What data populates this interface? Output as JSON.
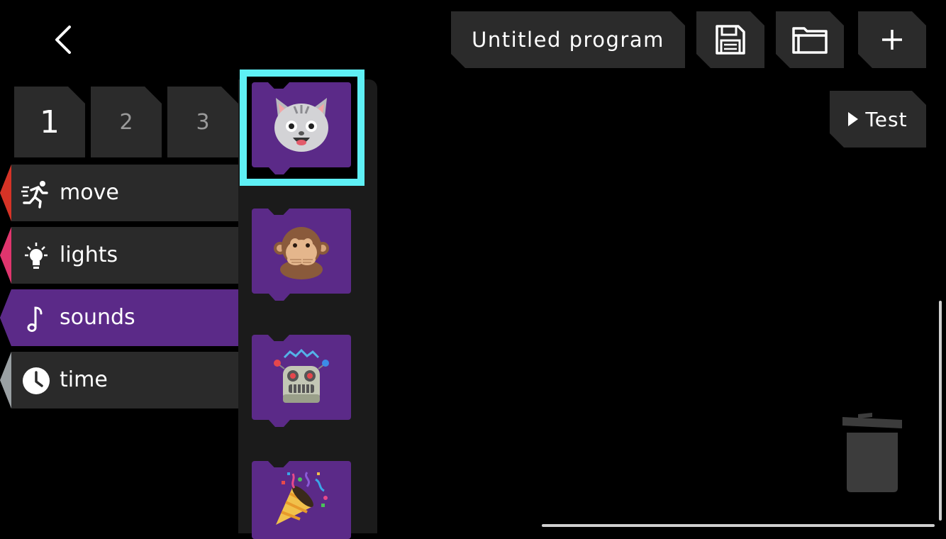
{
  "header": {
    "back_icon": "chevron-left-icon",
    "program_title": "Untitled program",
    "save_icon": "floppy-disk-icon",
    "open_icon": "folder-icon",
    "new_icon": "plus-icon",
    "test_label": "Test",
    "test_icon": "play-triangle-icon"
  },
  "pages": [
    {
      "label": "1",
      "active": true
    },
    {
      "label": "2",
      "active": false
    },
    {
      "label": "3",
      "active": false
    }
  ],
  "categories": [
    {
      "label": "move",
      "icon": "running-person-icon",
      "color": "#d63326"
    },
    {
      "label": "lights",
      "icon": "lightbulb-icon",
      "color": "#e0356e"
    },
    {
      "label": "sounds",
      "icon": "music-note-icon",
      "color": "#5b2a88",
      "active": true
    },
    {
      "label": "time",
      "icon": "clock-icon",
      "color": "#9aa0a3"
    }
  ],
  "palette_blocks": [
    {
      "name": "cat-sound-block",
      "icon": "cat-face-icon",
      "selected": true
    },
    {
      "name": "monkey-sound-block",
      "icon": "speak-no-evil-monkey-icon"
    },
    {
      "name": "robot-sound-block",
      "icon": "robot-icon"
    },
    {
      "name": "party-sound-block",
      "icon": "party-popper-icon"
    }
  ],
  "colors": {
    "selection_outline": "#5ef0f5",
    "block_purple": "#5b2a88",
    "tile_dark": "#2b2b2b"
  },
  "canvas": {
    "trash_icon": "trash-can-icon"
  }
}
